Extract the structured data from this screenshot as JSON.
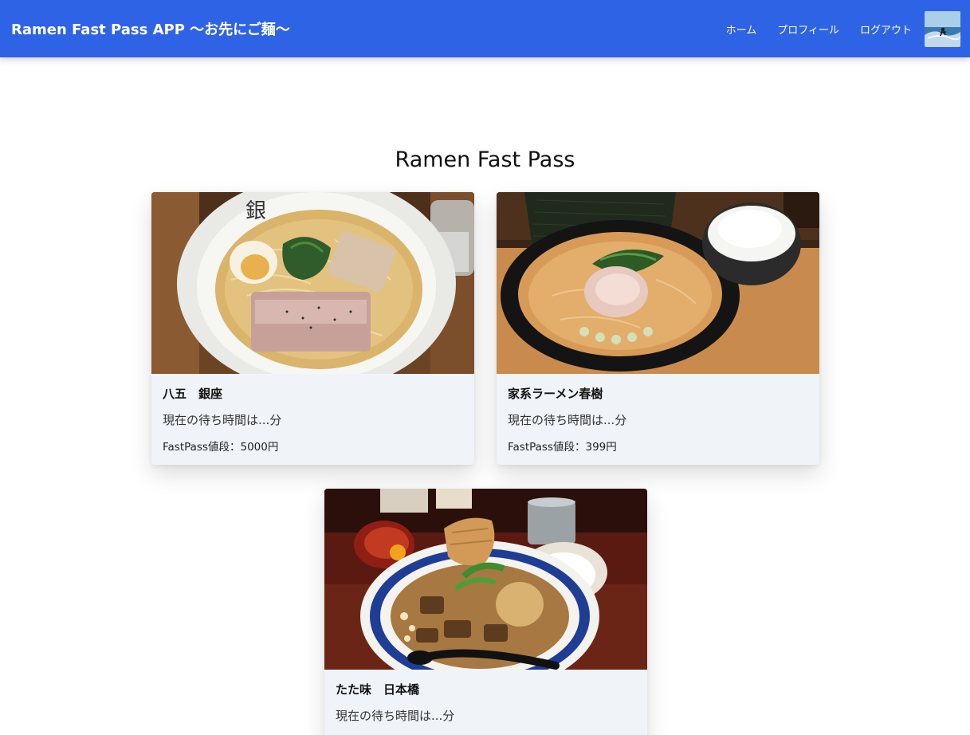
{
  "navbar": {
    "brand": "Ramen Fast Pass APP 〜お先にご麺〜",
    "links": [
      {
        "label": "ホーム"
      },
      {
        "label": "プロフィール"
      },
      {
        "label": "ログアウト"
      }
    ],
    "avatar_icon": "user-avatar-surfing-photo",
    "color": "#2f63e6"
  },
  "main": {
    "title": "Ramen Fast Pass",
    "shops": [
      {
        "name": "八五　銀座",
        "wait": "現在の待ち時間は...分",
        "price": "FastPass値段：5000円",
        "image_icon": "shio-ramen-photo"
      },
      {
        "name": "家系ラーメン春樹",
        "wait": "現在の待ち時間は...分",
        "price": "FastPass値段：399円",
        "image_icon": "iekei-ramen-photo"
      },
      {
        "name": "たた味　日本橋",
        "wait": "現在の待ち時間は...分",
        "image_icon": "stamina-ramen-photo"
      }
    ]
  }
}
